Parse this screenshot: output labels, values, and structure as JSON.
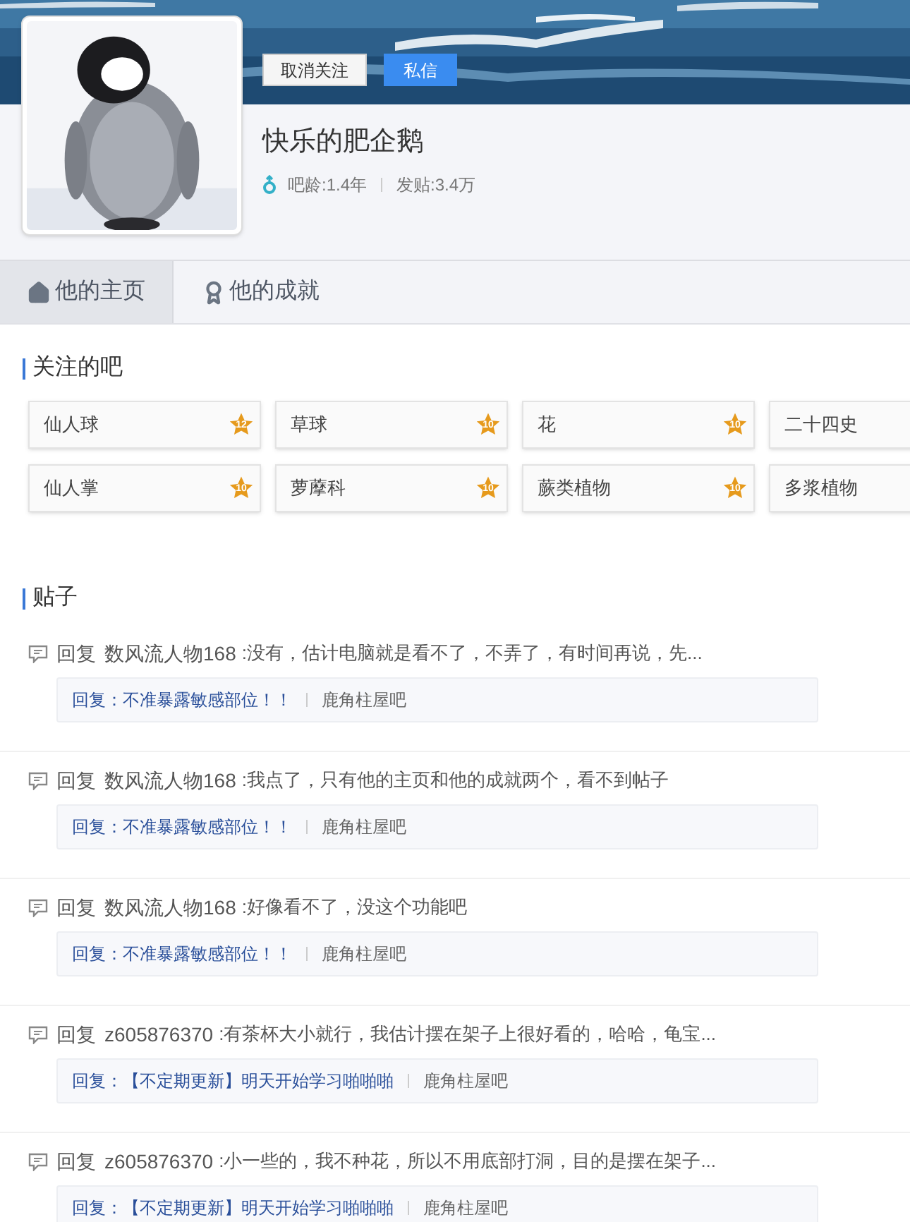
{
  "profile": {
    "name": "快乐的肥企鹅",
    "buttons": [
      {
        "label": "取消关注",
        "kind": "secondary"
      },
      {
        "label": "私信",
        "kind": "primary"
      }
    ],
    "stats": [
      "吧龄:1.4年",
      "发贴:3.4万"
    ]
  },
  "tabs": [
    {
      "label": "他的主页",
      "kind": "home",
      "selected": true
    },
    {
      "label": "他的成就",
      "kind": "award",
      "selected": false
    }
  ],
  "followed": {
    "title": "关注的吧",
    "bars": [
      {
        "name": "仙人球",
        "badge": "12"
      },
      {
        "name": "草球",
        "badge": "10"
      },
      {
        "name": "花",
        "badge": "10"
      },
      {
        "name": "二十四史"
      },
      {
        "name": "仙人掌",
        "badge": "10"
      },
      {
        "name": "萝藦科",
        "badge": "10"
      },
      {
        "name": "蕨类植物",
        "badge": "10"
      },
      {
        "name": "多浆植物"
      }
    ]
  },
  "posts": {
    "title": "贴子",
    "items": [
      {
        "action": "回复",
        "user": "数风流人物168",
        "text": ":没有，估计电脑就是看不了，不弄了，有时间再说，先...",
        "thread": "回复：不准暴露敏感部位！！",
        "forum": "鹿角柱屋吧"
      },
      {
        "action": "回复",
        "user": "数风流人物168",
        "text": ":我点了，只有他的主页和他的成就两个，看不到帖子",
        "thread": "回复：不准暴露敏感部位！！",
        "forum": "鹿角柱屋吧"
      },
      {
        "action": "回复",
        "user": "数风流人物168",
        "text": ":好像看不了，没这个功能吧",
        "thread": "回复：不准暴露敏感部位！！",
        "forum": "鹿角柱屋吧"
      },
      {
        "action": "回复",
        "user": "z605876370",
        "text": ":有茶杯大小就行，我估计摆在架子上很好看的，哈哈，龟宝...",
        "thread": "回复：【不定期更新】明天开始学习啪啪啪",
        "forum": "鹿角柱屋吧"
      },
      {
        "action": "回复",
        "user": "z605876370",
        "text": ":小一些的，我不种花，所以不用底部打洞，目的是摆在架子...",
        "thread": "回复：【不定期更新】明天开始学习啪啪啪",
        "forum": "鹿角柱屋吧"
      }
    ]
  }
}
